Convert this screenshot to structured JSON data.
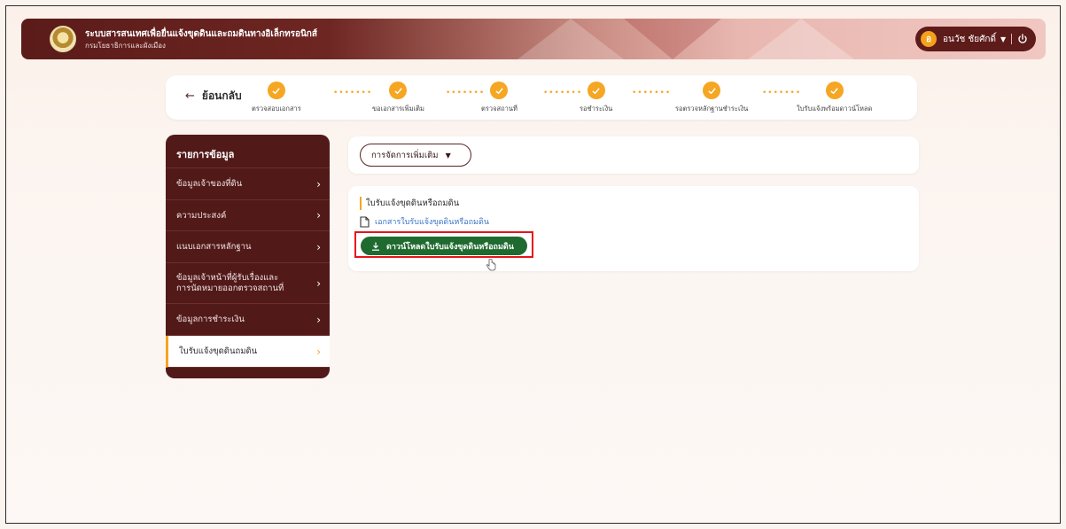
{
  "header": {
    "title": "ระบบสารสนเทศเพื่อยื่นแจ้งขุดดินและถมดินทางอิเล็กทรอนิกส์",
    "subtitle": "กรมโยธาธิการและผังเมือง",
    "user": {
      "initial": "อ",
      "name": "อนวัช ชัยศักดิ์",
      "caret": "▼"
    }
  },
  "stepper": {
    "back_label": "ย้อนกลับ",
    "steps": [
      {
        "label": "ตรวจสอบเอกสาร"
      },
      {
        "label": "ขอเอกสารเพิ่มเติม"
      },
      {
        "label": "ตรวจสถานที่"
      },
      {
        "label": "รอชำระเงิน"
      },
      {
        "label": "รอตรวจหลักฐานชำระเงิน"
      },
      {
        "label": "ใบรับแจ้งพร้อมดาวน์โหลด"
      }
    ],
    "connector": "•••••••"
  },
  "sidebar": {
    "title": "รายการข้อมูล",
    "items": [
      {
        "label": "ข้อมูลเจ้าของที่ดิน"
      },
      {
        "label": "ความประสงค์"
      },
      {
        "label": "แนบเอกสารหลักฐาน"
      },
      {
        "label_line1": "ข้อมูลเจ้าหน้าที่ผู้รับเรื่องและ",
        "label_line2": "การนัดหมายออกตรวจสถานที่"
      },
      {
        "label": "ข้อมูลการชำระเงิน"
      },
      {
        "label": "ใบรับแจ้งขุดดินถมดิน"
      }
    ],
    "chevron": "›"
  },
  "main": {
    "manage_button": {
      "label": "การจัดการเพิ่มเติม",
      "caret": "▼"
    },
    "section_title": "ใบรับแจ้งขุดดินหรือถมดิน",
    "document_link": "เอกสารใบรับแจ้งขุดดินหรือถมดิน",
    "download_button": "ดาวน์โหลดใบรับแจ้งขุดดินหรือถมดิน"
  },
  "colors": {
    "brand_dark": "#511a19",
    "accent_orange": "#f5a623",
    "download_green": "#1f6a2f",
    "highlight_red": "#e8131a",
    "link_blue": "#3b74c5"
  },
  "icons": {
    "back": "arrow-left-icon",
    "check": "check-icon",
    "document": "document-icon",
    "download": "download-icon",
    "power": "power-icon",
    "chevron": "chevron-right-icon"
  }
}
